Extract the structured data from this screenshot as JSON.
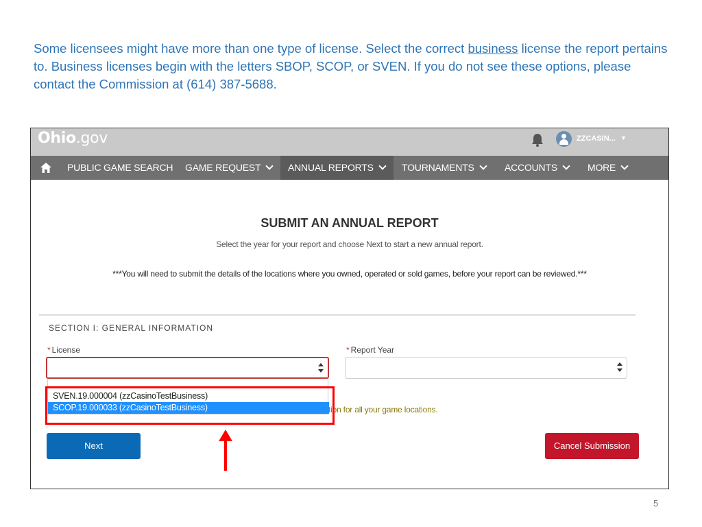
{
  "intro": {
    "part1": "Some licensees might have more than one type of license.  Select the correct ",
    "underlined": "business",
    "part2": " license the report pertains to. Business licenses begin with the letters SBOP, SCOP, or SVEN. If you do not see these options, please contact the Commission at (614) 387-5688."
  },
  "header": {
    "logo_bold_prefix": "O",
    "logo_bold": "hio",
    "logo_suffix": ".gov",
    "user_name": "ZZCASIN...",
    "icons": {
      "bell": "bell-icon",
      "avatar": "user-avatar-icon"
    }
  },
  "nav": {
    "items": [
      {
        "label": "PUBLIC GAME SEARCH"
      },
      {
        "label": "GAME REQUEST"
      },
      {
        "label": "ANNUAL REPORTS"
      },
      {
        "label": "TOURNAMENTS"
      },
      {
        "label": "ACCOUNTS"
      },
      {
        "label": "MORE"
      }
    ],
    "active": "ANNUAL REPORTS"
  },
  "main": {
    "title": "SUBMIT AN ANNUAL REPORT",
    "subtitle": "Select the year for your report and choose Next to start a new annual report.",
    "notice": "***You will need to submit the details of the locations where you owned, operated or sold games, before your report can be reviewed.***",
    "section_title": "SECTION I: GENERAL INFORMATION",
    "license_label": "License",
    "report_year_label": "Report Year",
    "required_mark": "*",
    "license_options": [
      {
        "label": "SVEN.19.000004 (zzCasinoTestBusiness)"
      },
      {
        "label": "SCOP.19.000033 (zzCasinoTestBusiness)"
      }
    ],
    "selected_option": "SCOP.19.000033 (zzCasinoTestBusiness)",
    "help_text_visible": "tion for all your game locations.",
    "next_label": "Next",
    "cancel_label": "Cancel Submission"
  },
  "colors": {
    "intro_text": "#2e75b6",
    "next_button": "#0b6ab5",
    "cancel_button": "#c4162a",
    "highlight": "#ff0000",
    "selected_option": "#1e90ff"
  },
  "page_number": "5"
}
